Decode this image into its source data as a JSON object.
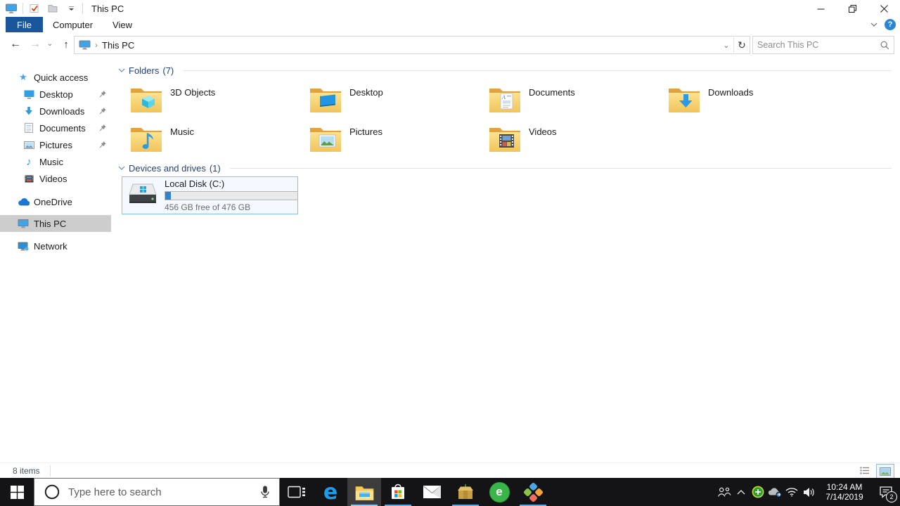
{
  "window": {
    "title": "This PC"
  },
  "glyphs": {
    "back": "←",
    "forward": "→",
    "up": "↑",
    "chevron_small": "⌄",
    "breadcrumb_sep": "›",
    "refresh": "↻",
    "close": "×",
    "star": "★",
    "music_note": "♪",
    "help": "?"
  },
  "ribbon": {
    "tabs": [
      {
        "label": "File"
      },
      {
        "label": "Computer"
      },
      {
        "label": "View"
      }
    ],
    "active_tab": "File"
  },
  "navbar": {
    "breadcrumb": {
      "root": "This PC"
    },
    "search_placeholder": "Search This PC"
  },
  "sidebar": {
    "items": [
      {
        "label": "Quick access",
        "pinned": false
      },
      {
        "label": "Desktop",
        "pinned": true
      },
      {
        "label": "Downloads",
        "pinned": true
      },
      {
        "label": "Documents",
        "pinned": true
      },
      {
        "label": "Pictures",
        "pinned": true
      },
      {
        "label": "Music",
        "pinned": false
      },
      {
        "label": "Videos",
        "pinned": false
      },
      {
        "label": "OneDrive",
        "pinned": false
      },
      {
        "label": "This PC",
        "pinned": false,
        "selected": true
      },
      {
        "label": "Network",
        "pinned": false
      }
    ]
  },
  "main": {
    "folders": {
      "label": "Folders",
      "count": "(7)",
      "items": [
        {
          "name": "3D Objects"
        },
        {
          "name": "Desktop"
        },
        {
          "name": "Documents"
        },
        {
          "name": "Downloads"
        },
        {
          "name": "Music"
        },
        {
          "name": "Pictures"
        },
        {
          "name": "Videos"
        }
      ]
    },
    "devices": {
      "label": "Devices and drives",
      "count": "(1)",
      "drive": {
        "name": "Local Disk (C:)",
        "capacity_text": "456 GB free of 476 GB",
        "used_percent": 4.2
      }
    }
  },
  "statusbar": {
    "items_text": "8 items"
  },
  "taskbar": {
    "search_placeholder": "Type here to search",
    "clock": {
      "time": "10:24 AM",
      "date": "7/14/2019"
    },
    "notification_badge": "2"
  },
  "colors": {
    "file_tab": "#19569c",
    "selection_border": "#84c3ea",
    "drive_bar_fill": "#2e83d4",
    "taskbar_underline": "#6aa9dd"
  }
}
